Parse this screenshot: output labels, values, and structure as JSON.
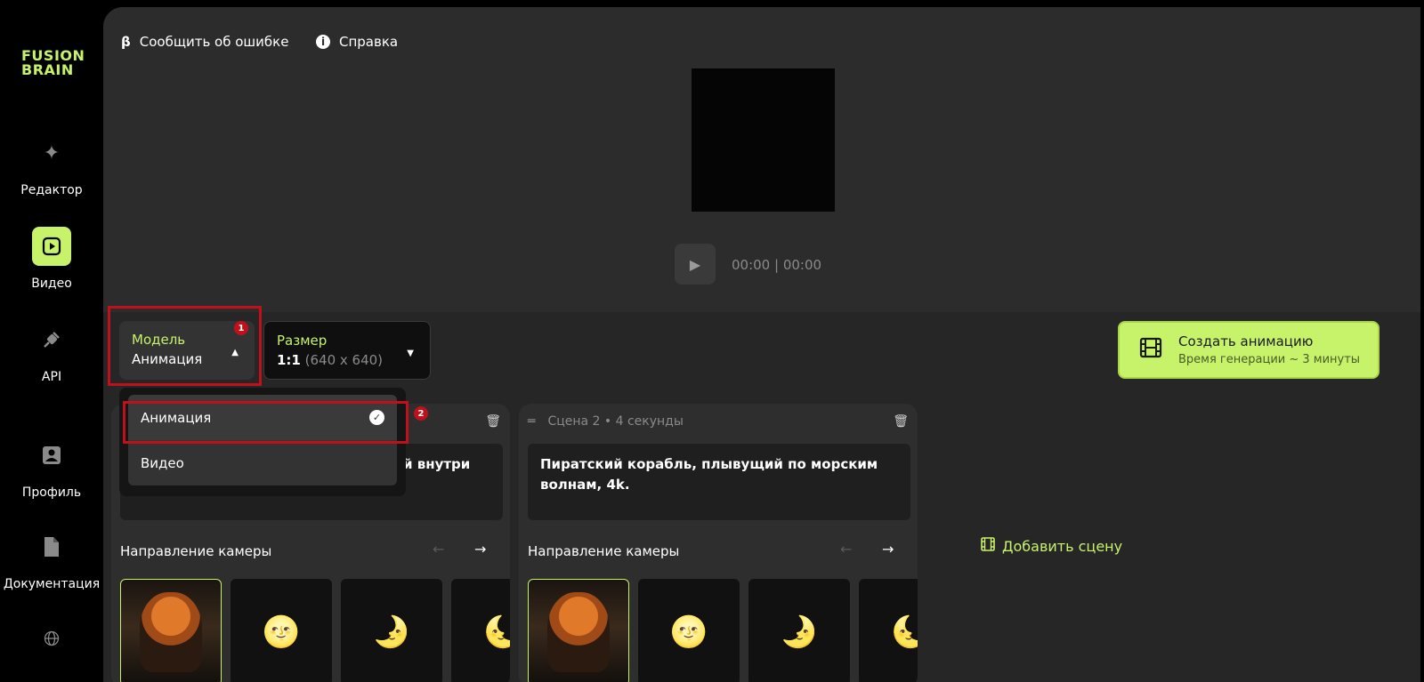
{
  "sidebar": {
    "logo_line1": "FUSION",
    "logo_line2": "BRAIN",
    "items": [
      {
        "label": "Редактор",
        "icon": "sparkles-icon"
      },
      {
        "label": "Видео",
        "icon": "play-icon"
      },
      {
        "label": "API",
        "icon": "plug-icon"
      },
      {
        "label": "Профиль",
        "icon": "user-icon"
      },
      {
        "label": "Документация",
        "icon": "document-icon"
      },
      {
        "label": "",
        "icon": "globe-icon"
      }
    ]
  },
  "topbar": {
    "report_label": "Сообщить об ошибке",
    "help_label": "Справка"
  },
  "player": {
    "time": "00:00 | 00:00"
  },
  "controls": {
    "model_label": "Модель",
    "model_value": "Анимация",
    "size_label": "Размер",
    "size_ratio": "1:1",
    "size_px": "(640 x 640)"
  },
  "create_button": {
    "title": "Создать анимацию",
    "subtitle": "Время генерации ~ 3 минуты"
  },
  "dropdown": {
    "options": [
      "Анимация",
      "Видео"
    ],
    "selected": "Анимация"
  },
  "badges": [
    "1",
    "2"
  ],
  "scenes": [
    {
      "prompt": "й внутри",
      "camera_title": "Направление камеры"
    },
    {
      "title": "Сцена 2 • 4 секунды",
      "prompt": "Пиратский корабль, плывущий по морским волнам, 4k.",
      "camera_title": "Направление камеры"
    }
  ],
  "add_scene_label": "Добавить сцену",
  "colors": {
    "accent": "#c7f36b",
    "highlight": "#c0101c",
    "panel": "#262626"
  }
}
